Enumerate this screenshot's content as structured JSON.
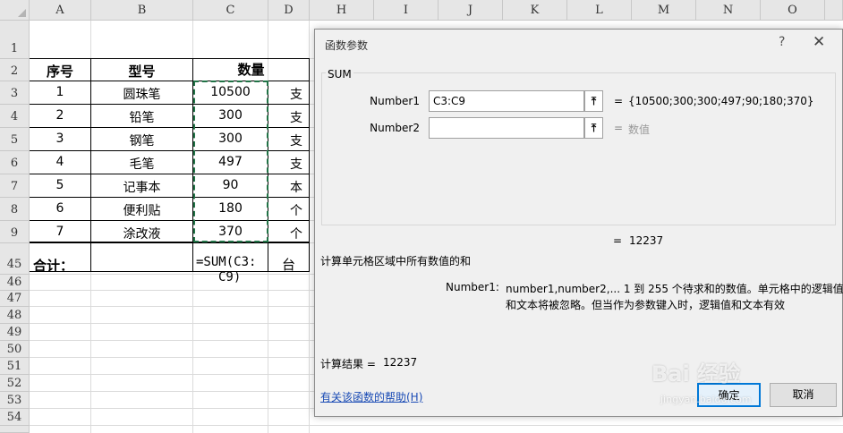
{
  "columns": [
    "A",
    "B",
    "C",
    "D",
    "H",
    "I",
    "J",
    "K",
    "L",
    "M",
    "N",
    "O"
  ],
  "rows": [
    "1",
    "2",
    "3",
    "4",
    "5",
    "6",
    "7",
    "8",
    "9",
    "45",
    "46",
    "47",
    "48",
    "49",
    "50",
    "51",
    "52",
    "53",
    "54"
  ],
  "table": {
    "headers": {
      "seq": "序号",
      "type": "型号",
      "qty": "数量"
    },
    "data": [
      {
        "seq": "1",
        "type": "圆珠笔",
        "qty": "10500",
        "unit": "支"
      },
      {
        "seq": "2",
        "type": "铅笔",
        "qty": "300",
        "unit": "支"
      },
      {
        "seq": "3",
        "type": "钢笔",
        "qty": "300",
        "unit": "支"
      },
      {
        "seq": "4",
        "type": "毛笔",
        "qty": "497",
        "unit": "支"
      },
      {
        "seq": "5",
        "type": "记事本",
        "qty": "90",
        "unit": "本"
      },
      {
        "seq": "6",
        "type": "便利贴",
        "qty": "180",
        "unit": "个"
      },
      {
        "seq": "7",
        "type": "涂改液",
        "qty": "370",
        "unit": "个"
      }
    ],
    "total_label": "合计：",
    "formula_line1": "=SUM(C3:",
    "formula_line2": "C9)",
    "total_unit": "台"
  },
  "dialog": {
    "title": "函数参数",
    "help_glyph": "?",
    "close_glyph": "✕",
    "function_name": "SUM",
    "arg1_label": "Number1",
    "arg1_value": "C3:C9",
    "arg1_result": "{10500;300;300;497;90;180;370}",
    "arg2_label": "Number2",
    "arg2_value": "",
    "arg2_result": "数值",
    "equals": "=",
    "formula_result": "12237",
    "description": "计算单元格区域中所有数值的和",
    "arg_help_label": "Number1:",
    "arg_help_text_1": "number1,number2,...  1 到 255 个待求和的数值。单元格中的逻辑值",
    "arg_help_text_2": "和文本将被忽略。但当作为参数键入时，逻辑值和文本有效",
    "calc_result_label": "计算结果 =",
    "calc_result_value": "12237",
    "help_link": "有关该函数的帮助(H)",
    "ok_label": "确定",
    "cancel_label": "取消",
    "ref_button_glyph": "⤒"
  },
  "watermark": {
    "line1": "Bai 经验",
    "line2": "jingyan.baidu.com"
  }
}
